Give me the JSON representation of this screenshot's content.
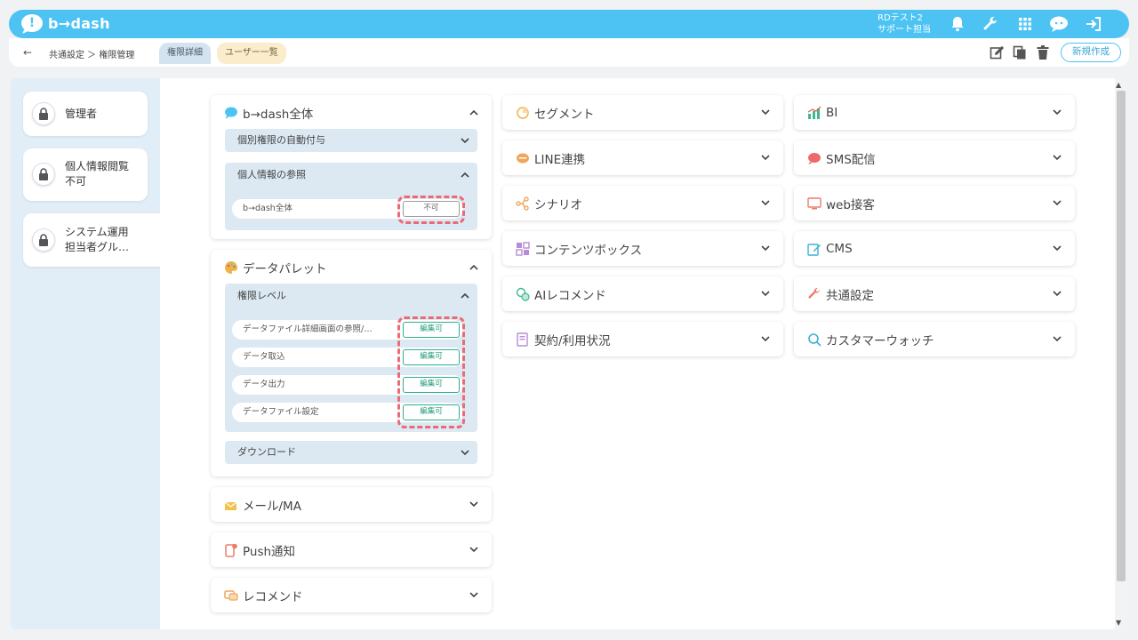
{
  "app": {
    "logo_text": "b→dash",
    "user_line1": "RDテスト2",
    "user_line2": "サポート担当"
  },
  "topbar_icons": [
    "bell-icon",
    "wrench-icon",
    "grid-icon",
    "chat-bot-icon",
    "logout-icon"
  ],
  "subbar": {
    "back_label": "←",
    "breadcrumb": "共通設定 ＞ 権限管理",
    "tabs": [
      {
        "label": "権限詳細",
        "active": true
      },
      {
        "label": "ユーザー一覧",
        "active": false
      }
    ],
    "new_button": "新規作成"
  },
  "sidebar": {
    "items": [
      {
        "label": "管理者"
      },
      {
        "label1": "個人情報閲覧",
        "label2": "不可"
      },
      {
        "label1": "システム運用",
        "label2": "担当者グル…"
      }
    ]
  },
  "col1": {
    "bdash": {
      "title": "b→dash全体",
      "sub1": "個別権限の自動付与",
      "sub2": "個人情報の参照",
      "row_label": "b→dash全体",
      "row_value": "不可"
    },
    "datapalette": {
      "title": "データパレット",
      "sub1": "権限レベル",
      "rows": [
        {
          "label": "データファイル詳細画面の参照/…",
          "value": "編集可"
        },
        {
          "label": "データ取込",
          "value": "編集可"
        },
        {
          "label": "データ出力",
          "value": "編集可"
        },
        {
          "label": "データファイル設定",
          "value": "編集可"
        }
      ],
      "sub2": "ダウンロード"
    },
    "mail": "メール/MA",
    "push": "Push通知",
    "recommend": "レコメンド"
  },
  "col2": [
    "セグメント",
    "LINE連携",
    "シナリオ",
    "コンテンツボックス",
    "AIレコメンド",
    "契約/利用状況"
  ],
  "col3": [
    "BI",
    "SMS配信",
    "web接客",
    "CMS",
    "共通設定",
    "カスタマーウォッチ"
  ],
  "colors": {
    "accent": "#4cc3f3",
    "ok": "#2bb08a",
    "highlight": "#ec6a76"
  }
}
